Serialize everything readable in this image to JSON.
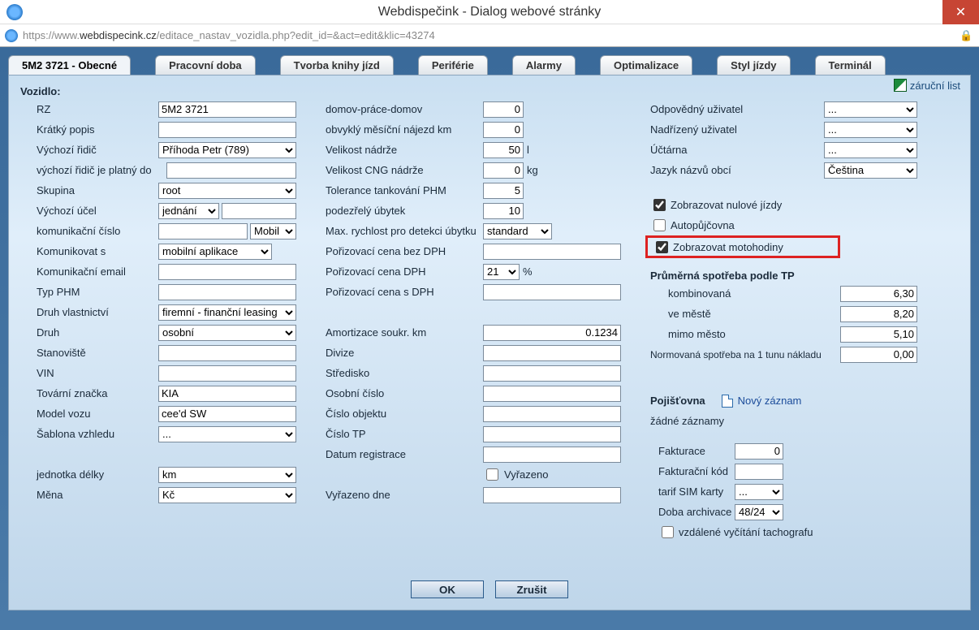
{
  "window": {
    "title": "Webdispečink - Dialog webové stránky",
    "url_gray1": "https://www.",
    "url_dark": "webdispecink.cz",
    "url_gray2": "/editace_nastav_vozidla.php?edit_id=&act=edit&klic=43274"
  },
  "tabs": [
    "5M2 3721 - Obecné",
    "Pracovní doba",
    "Tvorba knihy jízd",
    "Periférie",
    "Alarmy",
    "Optimalizace",
    "Styl jízdy",
    "Terminál"
  ],
  "zarucni": "záruční list",
  "heading": "Vozidlo:",
  "col1": {
    "rz": {
      "label": "RZ",
      "value": "5M2 3721"
    },
    "kratky": {
      "label": "Krátký popis",
      "value": ""
    },
    "ridic": {
      "label": "Výchozí řidič",
      "value": "Příhoda Petr (789)"
    },
    "ridic_do": {
      "label": "výchozí řidič je platný do",
      "value": ""
    },
    "skupina": {
      "label": "Skupina",
      "value": "root"
    },
    "ucel": {
      "label": "Výchozí účel",
      "value": "jednání"
    },
    "komcislo": {
      "label": "komunikační číslo",
      "value": "",
      "typ": "Mobil"
    },
    "komunikovat": {
      "label": "Komunikovat s",
      "value": "mobilní aplikace"
    },
    "email": {
      "label": "Komunikační email",
      "value": ""
    },
    "phm": {
      "label": "Typ PHM",
      "value": ""
    },
    "vlast": {
      "label": "Druh vlastnictví",
      "value": "firemní - finanční leasing"
    },
    "druh": {
      "label": "Druh",
      "value": "osobní"
    },
    "stan": {
      "label": "Stanoviště",
      "value": ""
    },
    "vin": {
      "label": "VIN",
      "value": ""
    },
    "znacka": {
      "label": "Tovární značka",
      "value": "KIA"
    },
    "model": {
      "label": "Model vozu",
      "value": "cee'd SW"
    },
    "sablona": {
      "label": "Šablona vzhledu",
      "value": "..."
    },
    "jednotka": {
      "label": "jednotka délky",
      "value": "km"
    },
    "mena": {
      "label": "Měna",
      "value": "Kč"
    }
  },
  "col2": {
    "dpd": {
      "label": "domov-práce-domov",
      "value": "0"
    },
    "najezd": {
      "label": "obvyklý měsíční nájezd km",
      "value": "0"
    },
    "nadrz": {
      "label": "Velikost nádrže",
      "value": "50",
      "unit": "l"
    },
    "cng": {
      "label": "Velikost CNG nádrže",
      "value": "0",
      "unit": "kg"
    },
    "tol": {
      "label": "Tolerance tankování PHM",
      "value": "5"
    },
    "ubytek": {
      "label": "podezřelý úbytek",
      "value": "10"
    },
    "rychlost": {
      "label": "Max. rychlost pro detekci úbytku",
      "value": "standard"
    },
    "cenabez": {
      "label": "Pořizovací cena bez DPH",
      "value": ""
    },
    "dph": {
      "label": "Pořizovací cena DPH",
      "value": "21",
      "unit": "%"
    },
    "cenas": {
      "label": "Pořizovací cena s DPH",
      "value": ""
    },
    "amort": {
      "label": "Amortizace soukr. km",
      "value": "0.1234"
    },
    "divize": {
      "label": "Divize",
      "value": ""
    },
    "stredisko": {
      "label": "Středisko",
      "value": ""
    },
    "oscislo": {
      "label": "Osobní číslo",
      "value": ""
    },
    "cobjektu": {
      "label": "Číslo objektu",
      "value": ""
    },
    "ctp": {
      "label": "Číslo TP",
      "value": ""
    },
    "datreg": {
      "label": "Datum registrace",
      "value": ""
    },
    "vyrazeno": {
      "label": "Vyřazeno"
    },
    "vyrazdne": {
      "label": "Vyřazeno dne",
      "value": ""
    }
  },
  "col3": {
    "odp": {
      "label": "Odpovědný uživatel",
      "value": "..."
    },
    "nad": {
      "label": "Nadřízený uživatel",
      "value": "..."
    },
    "uct": {
      "label": "Účtárna",
      "value": "..."
    },
    "jazyk": {
      "label": "Jazyk názvů obcí",
      "value": "Čeština"
    },
    "chk_nul": {
      "label": "Zobrazovat nulové jízdy",
      "checked": true
    },
    "chk_auto": {
      "label": "Autopůjčovna",
      "checked": false
    },
    "chk_moto": {
      "label": "Zobrazovat motohodiny",
      "checked": true
    },
    "spotreba_head": "Průměrná spotřeba podle TP",
    "komb": {
      "label": "kombinovaná",
      "value": "6,30"
    },
    "mesto": {
      "label": "ve městě",
      "value": "8,20"
    },
    "mimo": {
      "label": "mimo město",
      "value": "5,10"
    },
    "norm": {
      "label": "Normovaná spotřeba na 1 tunu nákladu",
      "value": "0,00"
    },
    "poj_head": "Pojišťovna",
    "novy": "Nový záznam",
    "zadne": "žádné záznamy",
    "fakt": {
      "label": "Fakturace",
      "value": "0"
    },
    "fkod": {
      "label": "Fakturační kód",
      "value": ""
    },
    "tarif": {
      "label": "tarif SIM karty",
      "value": "..."
    },
    "arch": {
      "label": "Doba archivace",
      "value": "48/24"
    },
    "tacho": {
      "label": "vzdálené vyčítání tachografu",
      "checked": false
    }
  },
  "buttons": {
    "ok": "OK",
    "cancel": "Zrušit"
  }
}
